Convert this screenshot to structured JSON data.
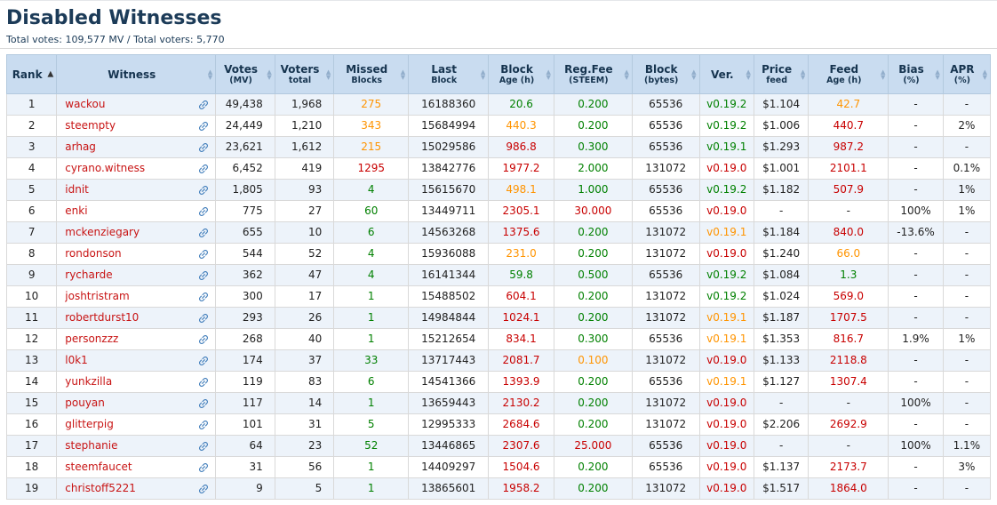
{
  "page": {
    "title": "Disabled Witnesses",
    "summary": "Total votes: 109,577 MV / Total voters: 5,770"
  },
  "colors": {
    "ok_green": "#008000",
    "warn_orange": "#ff9400",
    "alert_red": "#c80000",
    "witness_link_red": "#c81414",
    "chain_icon_blue": "#3f7cba",
    "header_bg": "#c9dcf0",
    "row_stripe": "#edf3fa"
  },
  "table": {
    "sorted_column": "rank",
    "sort_direction": "asc",
    "threshold_rank": "11",
    "columns": [
      {
        "key": "rank",
        "label": "Rank",
        "sub": "",
        "sort": "asc",
        "align": "center"
      },
      {
        "key": "witness",
        "label": "Witness",
        "sub": "",
        "sort": "both",
        "align": "left"
      },
      {
        "key": "votes",
        "label": "Votes",
        "sub": "(MV)",
        "sort": "both",
        "align": "right"
      },
      {
        "key": "voters",
        "label": "Voters",
        "sub": "total",
        "sort": "both",
        "align": "right"
      },
      {
        "key": "missed",
        "label": "Missed",
        "sub": "Blocks",
        "sort": "both",
        "align": "center"
      },
      {
        "key": "last_block",
        "label": "Last",
        "sub": "Block",
        "sort": "both",
        "align": "center"
      },
      {
        "key": "block_age",
        "label": "Block",
        "sub": "Age (h)",
        "sort": "both",
        "align": "center"
      },
      {
        "key": "reg_fee",
        "label": "Reg.Fee",
        "sub": "(STEEM)",
        "sort": "both",
        "align": "center"
      },
      {
        "key": "block_bytes",
        "label": "Block",
        "sub": "(bytes)",
        "sort": "both",
        "align": "center"
      },
      {
        "key": "version",
        "label": "Ver.",
        "sub": "",
        "sort": "both",
        "align": "center"
      },
      {
        "key": "price_feed",
        "label": "Price",
        "sub": "feed",
        "sort": "both",
        "align": "center"
      },
      {
        "key": "feed_age",
        "label": "Feed",
        "sub": "Age (h)",
        "sort": "both",
        "align": "center"
      },
      {
        "key": "bias",
        "label": "Bias",
        "sub": "(%)",
        "sort": "both",
        "align": "center"
      },
      {
        "key": "apr",
        "label": "APR",
        "sub": "(%)",
        "sort": "both",
        "align": "center"
      }
    ],
    "rows": [
      {
        "rank": "1",
        "witness": "wackou",
        "votes": "49,438",
        "voters": "1,968",
        "missed": [
          "275",
          "orange"
        ],
        "last_block": "16188360",
        "block_age": [
          "20.6",
          "green"
        ],
        "reg_fee": [
          "0.200",
          "green"
        ],
        "block_bytes": "65536",
        "version": [
          "v0.19.2",
          "green"
        ],
        "price_feed": "$1.104",
        "feed_age": [
          "42.7",
          "orange"
        ],
        "bias": "-",
        "apr": "-"
      },
      {
        "rank": "2",
        "witness": "steempty",
        "votes": "24,449",
        "voters": "1,210",
        "missed": [
          "343",
          "orange"
        ],
        "last_block": "15684994",
        "block_age": [
          "440.3",
          "orange"
        ],
        "reg_fee": [
          "0.200",
          "green"
        ],
        "block_bytes": "65536",
        "version": [
          "v0.19.2",
          "green"
        ],
        "price_feed": "$1.006",
        "feed_age": [
          "440.7",
          "red"
        ],
        "bias": "-",
        "apr": "2%"
      },
      {
        "rank": "3",
        "witness": "arhag",
        "votes": "23,621",
        "voters": "1,612",
        "missed": [
          "215",
          "orange"
        ],
        "last_block": "15029586",
        "block_age": [
          "986.8",
          "red"
        ],
        "reg_fee": [
          "0.300",
          "green"
        ],
        "block_bytes": "65536",
        "version": [
          "v0.19.1",
          "green"
        ],
        "price_feed": "$1.293",
        "feed_age": [
          "987.2",
          "red"
        ],
        "bias": "-",
        "apr": "-"
      },
      {
        "rank": "4",
        "witness": "cyrano.witness",
        "votes": "6,452",
        "voters": "419",
        "missed": [
          "1295",
          "red"
        ],
        "last_block": "13842776",
        "block_age": [
          "1977.2",
          "red"
        ],
        "reg_fee": [
          "2.000",
          "green"
        ],
        "block_bytes": "131072",
        "version": [
          "v0.19.0",
          "red"
        ],
        "price_feed": "$1.001",
        "feed_age": [
          "2101.1",
          "red"
        ],
        "bias": "-",
        "apr": "0.1%"
      },
      {
        "rank": "5",
        "witness": "idnit",
        "votes": "1,805",
        "voters": "93",
        "missed": [
          "4",
          "green"
        ],
        "last_block": "15615670",
        "block_age": [
          "498.1",
          "orange"
        ],
        "reg_fee": [
          "1.000",
          "green"
        ],
        "block_bytes": "65536",
        "version": [
          "v0.19.2",
          "green"
        ],
        "price_feed": "$1.182",
        "feed_age": [
          "507.9",
          "red"
        ],
        "bias": "-",
        "apr": "1%"
      },
      {
        "rank": "6",
        "witness": "enki",
        "votes": "775",
        "voters": "27",
        "missed": [
          "60",
          "green"
        ],
        "last_block": "13449711",
        "block_age": [
          "2305.1",
          "red"
        ],
        "reg_fee": [
          "30.000",
          "red"
        ],
        "block_bytes": "65536",
        "version": [
          "v0.19.0",
          "red"
        ],
        "price_feed": "-",
        "feed_age": "-",
        "bias": "100%",
        "apr": "1%"
      },
      {
        "rank": "7",
        "witness": "mckenziegary",
        "votes": "655",
        "voters": "10",
        "missed": [
          "6",
          "green"
        ],
        "last_block": "14563268",
        "block_age": [
          "1375.6",
          "red"
        ],
        "reg_fee": [
          "0.200",
          "green"
        ],
        "block_bytes": "131072",
        "version": [
          "v0.19.1",
          "orange"
        ],
        "price_feed": "$1.184",
        "feed_age": [
          "840.0",
          "red"
        ],
        "bias": "-13.6%",
        "apr": "-"
      },
      {
        "rank": "8",
        "witness": "rondonson",
        "votes": "544",
        "voters": "52",
        "missed": [
          "4",
          "green"
        ],
        "last_block": "15936088",
        "block_age": [
          "231.0",
          "orange"
        ],
        "reg_fee": [
          "0.200",
          "green"
        ],
        "block_bytes": "131072",
        "version": [
          "v0.19.0",
          "red"
        ],
        "price_feed": "$1.240",
        "feed_age": [
          "66.0",
          "orange"
        ],
        "bias": "-",
        "apr": "-"
      },
      {
        "rank": "9",
        "witness": "rycharde",
        "votes": "362",
        "voters": "47",
        "missed": [
          "4",
          "green"
        ],
        "last_block": "16141344",
        "block_age": [
          "59.8",
          "green"
        ],
        "reg_fee": [
          "0.500",
          "green"
        ],
        "block_bytes": "65536",
        "version": [
          "v0.19.2",
          "green"
        ],
        "price_feed": "$1.084",
        "feed_age": [
          "1.3",
          "green"
        ],
        "bias": "-",
        "apr": "-"
      },
      {
        "rank": "10",
        "witness": "joshtristram",
        "votes": "300",
        "voters": "17",
        "missed": [
          "1",
          "green"
        ],
        "last_block": "15488502",
        "block_age": [
          "604.1",
          "red"
        ],
        "reg_fee": [
          "0.200",
          "green"
        ],
        "block_bytes": "131072",
        "version": [
          "v0.19.2",
          "green"
        ],
        "price_feed": "$1.024",
        "feed_age": [
          "569.0",
          "red"
        ],
        "bias": "-",
        "apr": "-"
      },
      {
        "rank": "11",
        "witness": "robertdurst10",
        "votes": "293",
        "voters": "26",
        "missed": [
          "1",
          "green"
        ],
        "last_block": "14984844",
        "block_age": [
          "1024.1",
          "red"
        ],
        "reg_fee": [
          "0.200",
          "green"
        ],
        "block_bytes": "131072",
        "version": [
          "v0.19.1",
          "orange"
        ],
        "price_feed": "$1.187",
        "feed_age": [
          "1707.5",
          "red"
        ],
        "bias": "-",
        "apr": "-"
      },
      {
        "rank": "12",
        "witness": "personzzz",
        "votes": "268",
        "voters": "40",
        "missed": [
          "1",
          "green"
        ],
        "last_block": "15212654",
        "block_age": [
          "834.1",
          "red"
        ],
        "reg_fee": [
          "0.300",
          "green"
        ],
        "block_bytes": "65536",
        "version": [
          "v0.19.1",
          "orange"
        ],
        "price_feed": "$1.353",
        "feed_age": [
          "816.7",
          "red"
        ],
        "bias": "1.9%",
        "apr": "1%"
      },
      {
        "rank": "13",
        "witness": "l0k1",
        "votes": "174",
        "voters": "37",
        "missed": [
          "33",
          "green"
        ],
        "last_block": "13717443",
        "block_age": [
          "2081.7",
          "red"
        ],
        "reg_fee": [
          "0.100",
          "orange"
        ],
        "block_bytes": "131072",
        "version": [
          "v0.19.0",
          "red"
        ],
        "price_feed": "$1.133",
        "feed_age": [
          "2118.8",
          "red"
        ],
        "bias": "-",
        "apr": "-"
      },
      {
        "rank": "14",
        "witness": "yunkzilla",
        "votes": "119",
        "voters": "83",
        "missed": [
          "6",
          "green"
        ],
        "last_block": "14541366",
        "block_age": [
          "1393.9",
          "red"
        ],
        "reg_fee": [
          "0.200",
          "green"
        ],
        "block_bytes": "65536",
        "version": [
          "v0.19.1",
          "orange"
        ],
        "price_feed": "$1.127",
        "feed_age": [
          "1307.4",
          "red"
        ],
        "bias": "-",
        "apr": "-"
      },
      {
        "rank": "15",
        "witness": "pouyan",
        "votes": "117",
        "voters": "14",
        "missed": [
          "1",
          "green"
        ],
        "last_block": "13659443",
        "block_age": [
          "2130.2",
          "red"
        ],
        "reg_fee": [
          "0.200",
          "green"
        ],
        "block_bytes": "131072",
        "version": [
          "v0.19.0",
          "red"
        ],
        "price_feed": "-",
        "feed_age": "-",
        "bias": "100%",
        "apr": "-"
      },
      {
        "rank": "16",
        "witness": "glitterpig",
        "votes": "101",
        "voters": "31",
        "missed": [
          "5",
          "green"
        ],
        "last_block": "12995333",
        "block_age": [
          "2684.6",
          "red"
        ],
        "reg_fee": [
          "0.200",
          "green"
        ],
        "block_bytes": "131072",
        "version": [
          "v0.19.0",
          "red"
        ],
        "price_feed": "$2.206",
        "feed_age": [
          "2692.9",
          "red"
        ],
        "bias": "-",
        "apr": "-"
      },
      {
        "rank": "17",
        "witness": "stephanie",
        "votes": "64",
        "voters": "23",
        "missed": [
          "52",
          "green"
        ],
        "last_block": "13446865",
        "block_age": [
          "2307.6",
          "red"
        ],
        "reg_fee": [
          "25.000",
          "red"
        ],
        "block_bytes": "65536",
        "version": [
          "v0.19.0",
          "red"
        ],
        "price_feed": "-",
        "feed_age": "-",
        "bias": "100%",
        "apr": "1.1%"
      },
      {
        "rank": "18",
        "witness": "steemfaucet",
        "votes": "31",
        "voters": "56",
        "missed": [
          "1",
          "green"
        ],
        "last_block": "14409297",
        "block_age": [
          "1504.6",
          "red"
        ],
        "reg_fee": [
          "0.200",
          "green"
        ],
        "block_bytes": "65536",
        "version": [
          "v0.19.0",
          "red"
        ],
        "price_feed": "$1.137",
        "feed_age": [
          "2173.7",
          "red"
        ],
        "bias": "-",
        "apr": "3%"
      },
      {
        "rank": "19",
        "witness": "christoff5221",
        "votes": "9",
        "voters": "5",
        "missed": [
          "1",
          "green"
        ],
        "last_block": "13865601",
        "block_age": [
          "1958.2",
          "red"
        ],
        "reg_fee": [
          "0.200",
          "green"
        ],
        "block_bytes": "131072",
        "version": [
          "v0.19.0",
          "red"
        ],
        "price_feed": "$1.517",
        "feed_age": [
          "1864.0",
          "red"
        ],
        "bias": "-",
        "apr": "-"
      }
    ]
  }
}
